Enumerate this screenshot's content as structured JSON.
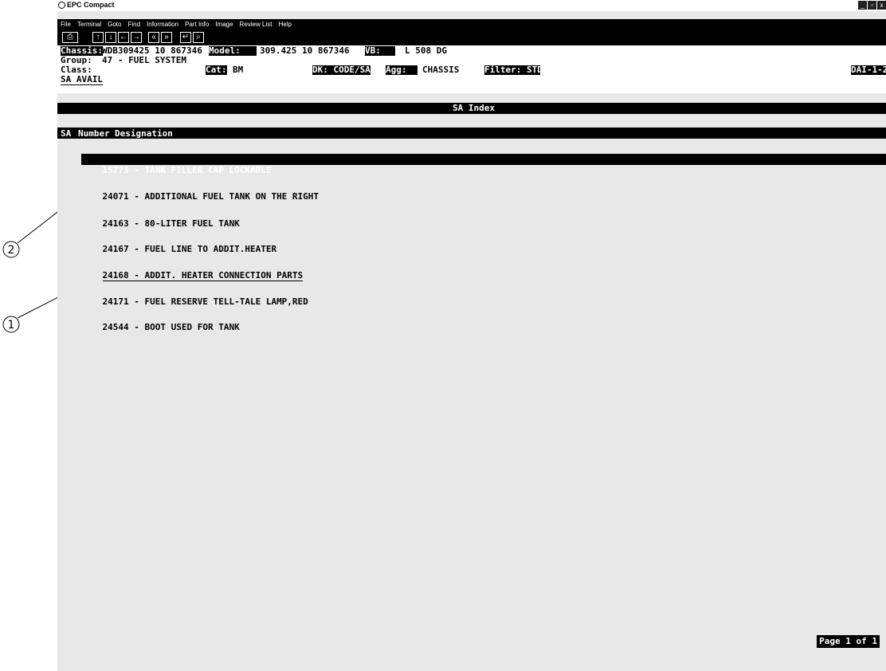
{
  "app": {
    "title": "EPC Compact"
  },
  "window_controls": [
    "_",
    "▫",
    "x"
  ],
  "menu": [
    "File",
    "Terminal",
    "Goto",
    "Find",
    "Information",
    "Part Info",
    "Image",
    "Review List",
    "Help"
  ],
  "header": {
    "chassis_label": "Chassis:",
    "chassis_value": "WDB309425 10 867346",
    "model_label": "Model:",
    "model_value": "309.425 10 867346",
    "vb_label": "VB:",
    "vb_value": "L 508 DG",
    "group_label": "Group:",
    "group_value": "47 - FUEL SYSTEM",
    "class_label": "Class:",
    "cat_label": "Cat:",
    "cat_value": "BM",
    "dk_label": "DK: CODE/SA",
    "agg_label": "Agg:",
    "agg_value": "CHASSIS",
    "filter_label": "Filter: STD",
    "code": "DAI-1-2",
    "sa_avail": "SA AVAIL"
  },
  "index": {
    "title": "SA Index",
    "col_sa": "SA",
    "col_number": "Number",
    "col_designation": "Designation"
  },
  "items": [
    {
      "number": "15773",
      "designation": "TANK FILLER CAP LOCKABLE"
    },
    {
      "number": "24071",
      "designation": "ADDITIONAL FUEL TANK ON THE RIGHT"
    },
    {
      "number": "24163",
      "designation": "80-LITER FUEL TANK"
    },
    {
      "number": "24167",
      "designation": "FUEL LINE TO ADDIT.HEATER"
    },
    {
      "number": "24168",
      "designation": "ADDIT. HEATER CONNECTION PARTS"
    },
    {
      "number": "24171",
      "designation": "FUEL RESERVE TELL-TALE LAMP,RED"
    },
    {
      "number": "24544",
      "designation": "BOOT USED FOR TANK"
    }
  ],
  "page_indicator": "Page 1 of 1",
  "callouts": [
    "2",
    "1"
  ]
}
